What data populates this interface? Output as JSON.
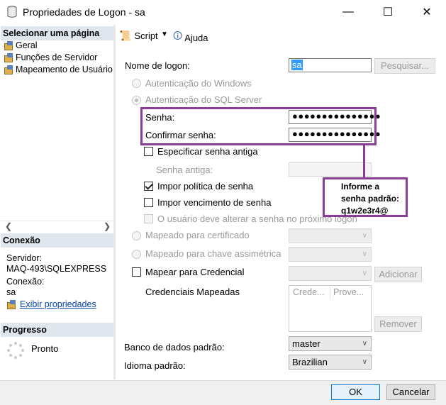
{
  "window": {
    "title": "Propriedades de Logon - sa",
    "colors": {
      "annotation": "#8a3d96",
      "link": "#0645ad",
      "selection": "#3399ff"
    }
  },
  "left_pane": {
    "select_page_header": "Selecionar uma página",
    "pages": [
      {
        "label": "Geral",
        "icon": "page-icon"
      },
      {
        "label": "Funções de Servidor",
        "icon": "page-icon"
      },
      {
        "label": "Mapeamento de Usuário",
        "icon": "page-icon"
      }
    ],
    "connection_header": "Conexão",
    "server_label": "Servidor:",
    "server_value": "MAQ-493\\SQLEXPRESS",
    "connection_label": "Conexão:",
    "connection_value": "sa",
    "view_properties_link": "Exibir propriedades",
    "progress_header": "Progresso",
    "progress_status": "Pronto"
  },
  "toolbar": {
    "script_label": "Script",
    "help_label": "Ajuda"
  },
  "form": {
    "login_name_label": "Nome de logon:",
    "login_name_value": "sa",
    "search_button": "Pesquisar...",
    "windows_auth": "Autenticação do Windows",
    "sql_auth": "Autenticação do SQL Server",
    "password_label": "Senha:",
    "password_value": "●●●●●●●●●●●●●●●",
    "confirm_password_label": "Confirmar senha:",
    "confirm_password_value": "●●●●●●●●●●●●●●●",
    "specify_old_password": "Especificar senha antiga",
    "old_password_label": "Senha antiga:",
    "enforce_policy": "Impor política de senha",
    "enforce_policy_checked": true,
    "enforce_expiration": "Impor vencimento de senha",
    "enforce_expiration_checked": false,
    "must_change": "O usuário deve alterar a senha no próximo logon",
    "mapped_certificate": "Mapeado para certificado",
    "mapped_asym_key": "Mapeado para chave assimétrica",
    "map_credential": "Mapear para Credencial",
    "add_button": "Adicionar",
    "mapped_credentials_label": "Credenciais Mapeadas",
    "credentials_columns": [
      "Crede...",
      "Prove..."
    ],
    "remove_button": "Remover",
    "default_db_label": "Banco de dados padrão:",
    "default_db_value": "master",
    "default_lang_label": "Idioma padrão:",
    "default_lang_value": "Brazilian"
  },
  "annotation": {
    "callout_text": "Informe a\nsenha padrão:\nq1w2e3r4@"
  },
  "footer": {
    "ok_button": "OK",
    "cancel_button": "Cancelar"
  }
}
